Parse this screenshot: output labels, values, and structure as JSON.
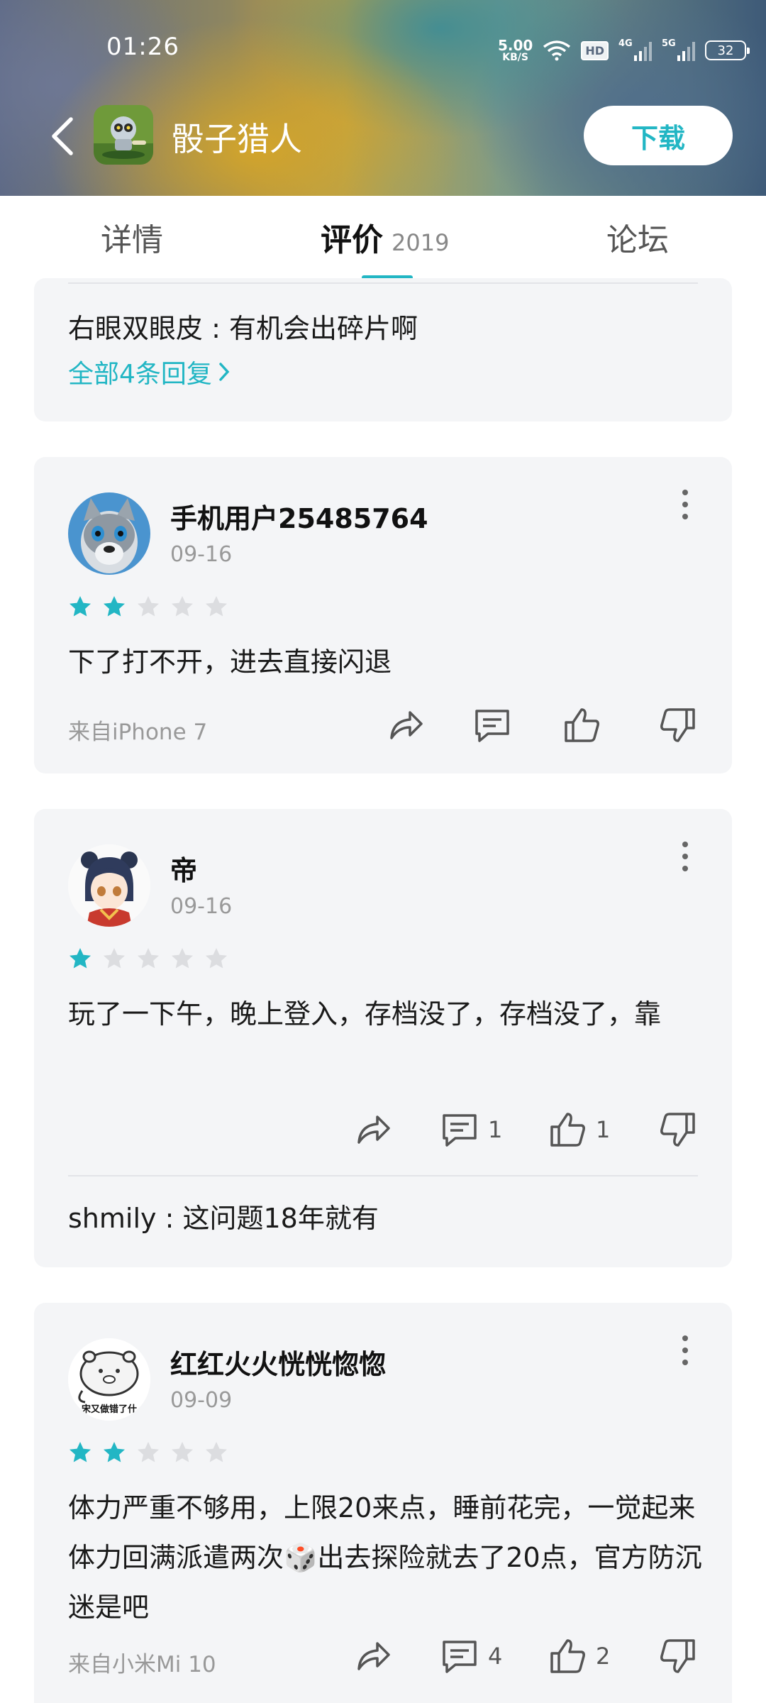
{
  "status_bar": {
    "time": "01:26",
    "net_speed_value": "5.00",
    "net_speed_unit": "KB/S",
    "hd_label": "HD",
    "signal1_label": "4G",
    "signal2_label": "5G",
    "battery": "32"
  },
  "header": {
    "app_name": "骰子猎人",
    "download_label": "下载"
  },
  "tabs": [
    {
      "label": "详情"
    },
    {
      "label": "评价",
      "count": "2019"
    },
    {
      "label": "论坛"
    }
  ],
  "accent_color": "#22b6c4",
  "top_card": {
    "reply": "右眼双眼皮 : 有机会出碎片啊",
    "more_replies": "全部4条回复"
  },
  "reviews": [
    {
      "username": "手机用户25485764",
      "date": "09-16",
      "rating": 2,
      "comment": "下了打不开，进去直接闪退",
      "source": "来自iPhone 7",
      "comments_count": "",
      "likes_count": ""
    },
    {
      "username": "帝",
      "date": "09-16",
      "rating": 1,
      "comment": "玩了一下午，晚上登入，存档没了，存档没了，靠",
      "source": "",
      "comments_count": "1",
      "likes_count": "1",
      "reply": "shmily : 这问题18年就有"
    },
    {
      "username": "红红火火恍恍惚惚",
      "date": "09-09",
      "rating": 2,
      "comment": "体力严重不够用，上限20来点，睡前花完，一觉起来体力回满派遣两次🎲出去探险就去了20点，官方防沉迷是吧",
      "source": "来自小米Mi 10",
      "comments_count": "4",
      "likes_count": "2",
      "avatar_caption": "宋又做错了什"
    }
  ]
}
